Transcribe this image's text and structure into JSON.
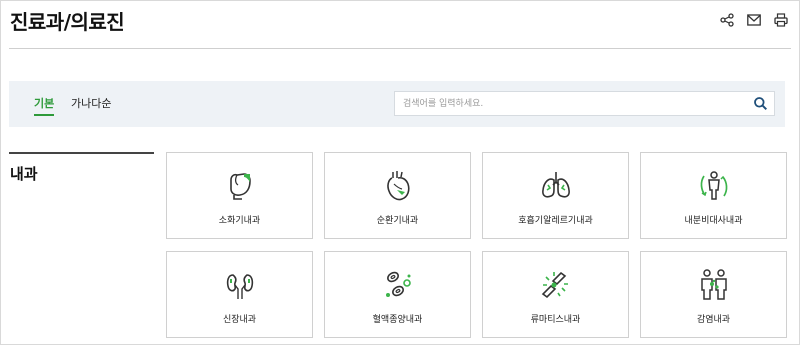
{
  "page": {
    "title": "진료과/의료진"
  },
  "tools": [
    {
      "name": "share-icon"
    },
    {
      "name": "mail-icon"
    },
    {
      "name": "print-icon"
    }
  ],
  "filter": {
    "tabs": [
      {
        "label": "기본",
        "active": true
      },
      {
        "label": "가나다순",
        "active": false
      }
    ],
    "search": {
      "placeholder": "검색어를 입력하세요.",
      "value": ""
    }
  },
  "section": {
    "title": "내과"
  },
  "departments": [
    {
      "label": "소화기내과",
      "icon": "stomach-icon"
    },
    {
      "label": "순환기내과",
      "icon": "heart-icon"
    },
    {
      "label": "호흡기알레르기내과",
      "icon": "lungs-icon"
    },
    {
      "label": "내분비대사내과",
      "icon": "body-metabolism-icon"
    },
    {
      "label": "신장내과",
      "icon": "kidneys-icon"
    },
    {
      "label": "혈액종양내과",
      "icon": "blood-cells-icon"
    },
    {
      "label": "류마티스내과",
      "icon": "joint-icon"
    },
    {
      "label": "감염내과",
      "icon": "infection-people-icon"
    }
  ],
  "colors": {
    "accent": "#2e9a3a",
    "icon_stroke": "#333333",
    "icon_accent": "#3cb44b",
    "filter_bg": "#eef2f6"
  }
}
